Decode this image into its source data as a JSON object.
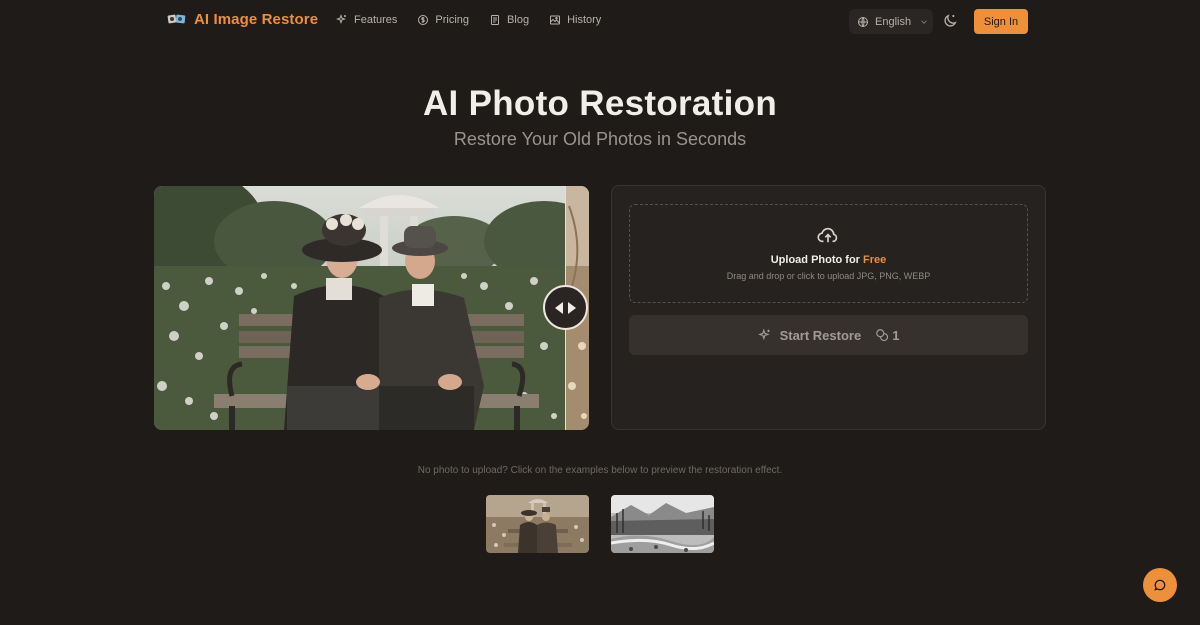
{
  "header": {
    "logo_text": "AI Image Restore",
    "nav": [
      {
        "label": "Features",
        "icon": "sparkles-icon"
      },
      {
        "label": "Pricing",
        "icon": "coin-icon"
      },
      {
        "label": "Blog",
        "icon": "document-icon"
      },
      {
        "label": "History",
        "icon": "image-history-icon"
      }
    ],
    "language": "English",
    "theme_icon": "moon-icon",
    "signin_label": "Sign In"
  },
  "hero": {
    "title": "AI Photo Restoration",
    "subtitle": "Restore Your Old Photos in Seconds"
  },
  "upload": {
    "title_prefix": "Upload Photo for ",
    "title_highlight": "Free",
    "hint": "Drag and drop or click to upload JPG, PNG, WEBP",
    "restore_label": "Start Restore",
    "credits": "1"
  },
  "examples": {
    "hint": "No photo to upload? Click on the examples below to preview the restoration effect."
  },
  "colors": {
    "accent": "#ee8f3a",
    "background": "#1e1b19",
    "panel": "#252220"
  }
}
